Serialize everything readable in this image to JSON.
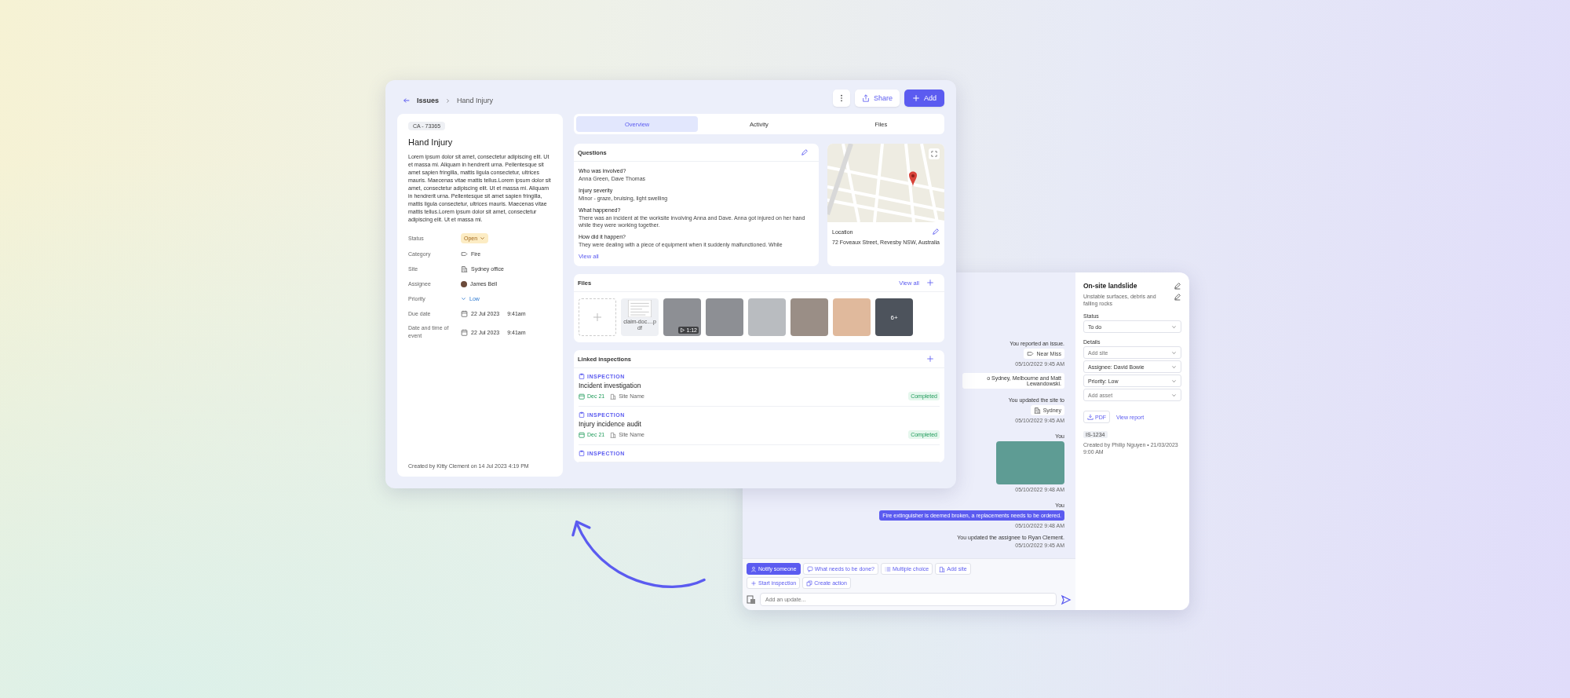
{
  "breadcrumb": {
    "parent": "Issues",
    "current": "Hand Injury"
  },
  "header_buttons": {
    "share": "Share",
    "add": "Add"
  },
  "issue": {
    "id": "CA - 73365",
    "title": "Hand Injury",
    "description": "Lorem ipsum dolor sit amet, consectetur adipiscing elit. Ut et massa mi. Aliquam in hendrerit urna. Pellentesque sit amet sapien fringilla, mattis ligula consectetur, ultrices mauris. Maecenas vitae mattis tellus.Lorem ipsum dolor sit amet, consectetur adipiscing elit. Ut et massa mi. Aliquam in hendrerit urna. Pellentesque sit amet sapien fringilla, mattis ligula consectetur, ultrices mauris. Maecenas vitae mattis tellus.Lorem ipsum dolor sit amet, consectetur adipiscing elit. Ut et massa mi.",
    "fields": [
      {
        "kind": "status",
        "label": "Status",
        "value": "Open"
      },
      {
        "kind": "category",
        "label": "Category",
        "value": "Fire"
      },
      {
        "kind": "site",
        "label": "Site",
        "value": "Sydney office"
      },
      {
        "kind": "person",
        "label": "Assignee",
        "value": "James Bell"
      },
      {
        "kind": "priority",
        "label": "Priority",
        "value": "Low"
      },
      {
        "kind": "date",
        "label": "Due date",
        "value": "22 Jul 2023",
        "time": "9:41am"
      },
      {
        "kind": "date",
        "label": "Date and time of event",
        "value": "22 Jul 2023",
        "time": "9:41am"
      }
    ],
    "footer": "Created by Kitty Clement on 14 Jul 2023 4:19 PM"
  },
  "tabs": [
    {
      "label": "Overview",
      "selected": true
    },
    {
      "label": "Activity",
      "selected": false
    },
    {
      "label": "Files",
      "selected": false
    }
  ],
  "questions": {
    "title": "Questions",
    "items": [
      {
        "question": "Who was involved?",
        "answer": "Anna Green, Dave Thomas"
      },
      {
        "question": "Injury severity",
        "answer": "Minor - graze, bruising, light swelling"
      },
      {
        "question": "What happened?",
        "answer": "There was an incident at the worksite involving Anna and Dave. Anna got injured on her hand while they were working together."
      },
      {
        "question": "How did it happen?",
        "answer": "They were dealing with a piece of equipment when it suddenly malfunctioned. While"
      }
    ],
    "link": "View all"
  },
  "location": {
    "label": "Location",
    "address": "72 Foveaux Street, Revesby NSW, Australia"
  },
  "files": {
    "title": "Files",
    "link": "View all",
    "items": [
      {
        "kind": "add"
      },
      {
        "kind": "document",
        "name": "claim-doc....pdf"
      },
      {
        "kind": "video",
        "duration": "1:12"
      },
      {
        "kind": "photo"
      },
      {
        "kind": "photo"
      },
      {
        "kind": "photo"
      },
      {
        "kind": "photo"
      },
      {
        "kind": "more",
        "count": "6+"
      }
    ]
  },
  "linked_inspections": {
    "title": "Linked inspections",
    "items": [
      {
        "type": "INSPECTION",
        "name": "Incident investigation",
        "date": "Dec 21",
        "site": "Site Name",
        "status": "Completed"
      },
      {
        "type": "INSPECTION",
        "name": "Injury incidence audit",
        "date": "Dec 21",
        "site": "Site Name",
        "status": "Completed"
      },
      {
        "type": "INSPECTION"
      }
    ]
  },
  "activity": {
    "messages": [
      {
        "kind": "event",
        "text": "You reported an issue.",
        "chip": {
          "kind": "category",
          "label": "Near Miss"
        },
        "time": "05/10/2022 9:45 AM"
      },
      {
        "kind": "bubble",
        "text": "o Sydney, Melbourne and Matt Lewandowski."
      },
      {
        "kind": "event",
        "text": "You updated the site to",
        "chip": {
          "kind": "site",
          "label": "Sydney"
        },
        "time": "05/10/2022 9:45 AM"
      },
      {
        "kind": "photo",
        "author": "You",
        "time": "05/10/2022 9:48 AM"
      },
      {
        "kind": "message",
        "author": "You",
        "text": "Fire extinguisher is deemed broken, a replacements needs to be ordered.",
        "time": "05/10/2022 9:48 AM"
      },
      {
        "kind": "event",
        "text": "You updated the assignee to Ryan Clement.",
        "time": "05/10/2022 9:45 AM"
      }
    ],
    "quick_actions": [
      {
        "kind": "notify",
        "label": "Notify someone",
        "selected": true
      },
      {
        "kind": "question",
        "label": "What needs to be done?",
        "selected": false
      },
      {
        "kind": "choice",
        "label": "Multiple choice",
        "selected": false
      },
      {
        "kind": "site",
        "label": "Add site",
        "selected": false
      },
      {
        "kind": "add",
        "label": "Start inspection",
        "selected": false
      },
      {
        "kind": "action",
        "label": "Create action",
        "selected": false
      }
    ],
    "composer": {
      "placeholder": "Add an update..."
    }
  },
  "side_panel": {
    "title": "On-site landslide",
    "description": "Unstable surfaces, debris and falling rocks",
    "status_label": "Status",
    "status": "To do",
    "details_label": "Details",
    "details": [
      {
        "placeholder": "Add site"
      },
      {
        "value": "Assignee: David Bowie"
      },
      {
        "value": "Priority: Low"
      },
      {
        "placeholder": "Add asset"
      }
    ],
    "pdf": "PDF",
    "link": "View report",
    "id": "IS-1234",
    "footer": "Created by Philip Nguyen • 21/03/2023 9:00 AM"
  }
}
